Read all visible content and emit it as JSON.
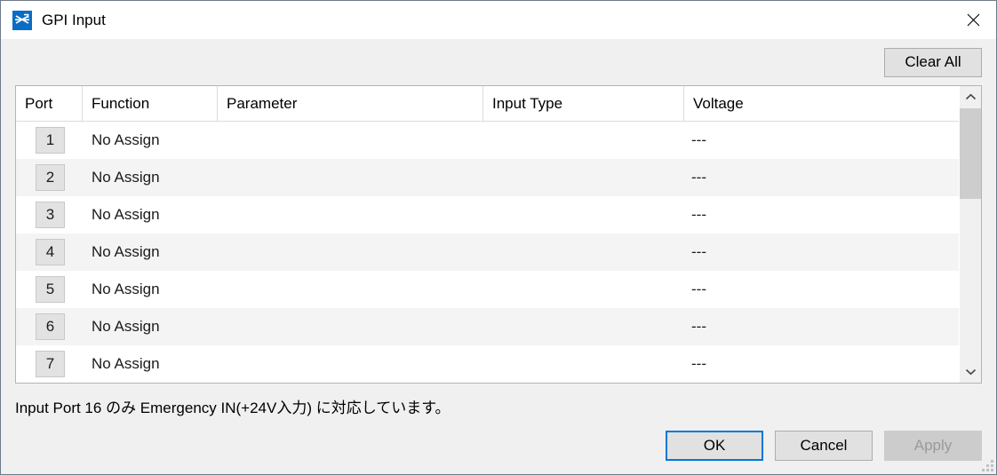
{
  "window": {
    "title": "GPI Input",
    "icon": "signal-crossover-icon",
    "close_label": "✕"
  },
  "toolbar": {
    "clear_all_label": "Clear All"
  },
  "table": {
    "columns": [
      {
        "key": "port",
        "label": "Port"
      },
      {
        "key": "function",
        "label": "Function"
      },
      {
        "key": "parameter",
        "label": "Parameter"
      },
      {
        "key": "input_type",
        "label": "Input Type"
      },
      {
        "key": "voltage",
        "label": "Voltage"
      }
    ],
    "rows": [
      {
        "port": "1",
        "function": "No Assign",
        "parameter": "",
        "input_type": "",
        "voltage": "---"
      },
      {
        "port": "2",
        "function": "No Assign",
        "parameter": "",
        "input_type": "",
        "voltage": "---"
      },
      {
        "port": "3",
        "function": "No Assign",
        "parameter": "",
        "input_type": "",
        "voltage": "---"
      },
      {
        "port": "4",
        "function": "No Assign",
        "parameter": "",
        "input_type": "",
        "voltage": "---"
      },
      {
        "port": "5",
        "function": "No Assign",
        "parameter": "",
        "input_type": "",
        "voltage": "---"
      },
      {
        "port": "6",
        "function": "No Assign",
        "parameter": "",
        "input_type": "",
        "voltage": "---"
      },
      {
        "port": "7",
        "function": "No Assign",
        "parameter": "",
        "input_type": "",
        "voltage": "---"
      }
    ],
    "scrollbar": {
      "up_arrow": "⌃",
      "down_arrow": "⌄"
    }
  },
  "note": {
    "text": "Input Port 16 のみ Emergency IN(+24V入力) に対応しています。"
  },
  "footer": {
    "ok_label": "OK",
    "cancel_label": "Cancel",
    "apply_label": "Apply"
  },
  "colors": {
    "accent": "#0078d7",
    "icon_blue": "#0a6cc4",
    "dialog_bg": "#f0f0f0",
    "row_alt": "#f4f4f4",
    "disabled_text": "#9a9a9a"
  }
}
